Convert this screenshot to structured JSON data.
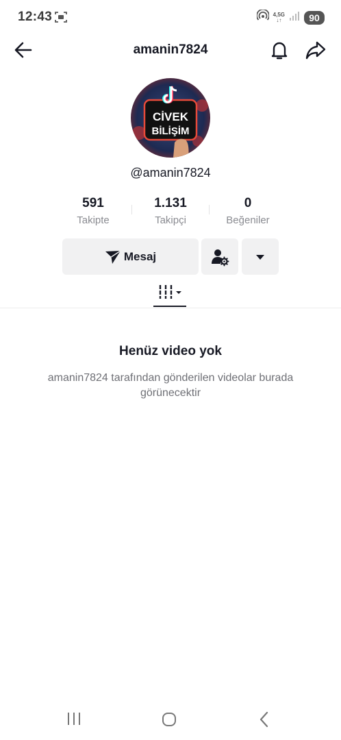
{
  "status_bar": {
    "time": "12:43",
    "network_top": "4,5G",
    "network_bottom": "↓↑",
    "battery": "90"
  },
  "header": {
    "title": "amanin7824",
    "back_icon": "arrow-left-icon",
    "bell_icon": "bell-icon",
    "share_icon": "share-arrow-icon"
  },
  "profile": {
    "avatar_text_line1": "CİVEK",
    "avatar_text_line2": "BİLİŞİM",
    "handle": "@amanin7824",
    "stats": [
      {
        "value": "591",
        "label": "Takipte"
      },
      {
        "value": "1.131",
        "label": "Takipçi"
      },
      {
        "value": "0",
        "label": "Beğeniler"
      }
    ]
  },
  "actions": {
    "message_label": "Mesaj",
    "message_icon": "send-icon",
    "friend_icon": "user-settings-icon",
    "more_icon": "caret-down-icon"
  },
  "tabs": {
    "videos_icon": "videos-grid-icon"
  },
  "empty_state": {
    "title": "Henüz video yok",
    "description": "amanin7824 tarafından gönderilen videolar burada görünecektir"
  },
  "colors": {
    "text": "#161823",
    "secondary": "#8a8b91",
    "button_bg": "#f1f1f2"
  }
}
